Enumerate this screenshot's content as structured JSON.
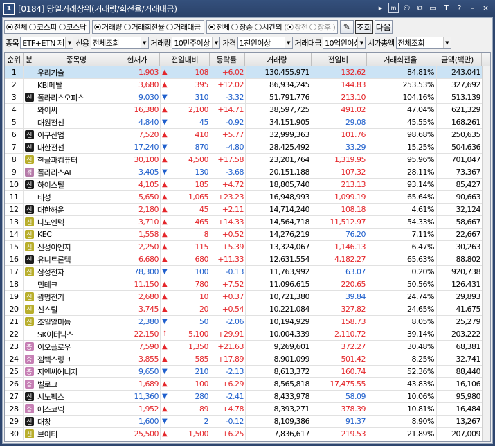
{
  "window": {
    "num": "1",
    "title": "[0184] 당일거래상위(거래량/회전율/거래대금)"
  },
  "market_options": [
    {
      "label": "전체",
      "on": true
    },
    {
      "label": "코스피",
      "on": false
    },
    {
      "label": "코스닥",
      "on": false
    }
  ],
  "sort_options": [
    {
      "label": "거래량",
      "on": true
    },
    {
      "label": "거래회전율",
      "on": false
    },
    {
      "label": "거래대금",
      "on": false
    }
  ],
  "session_options": [
    {
      "label": "전체",
      "on": true
    },
    {
      "label": "장중",
      "on": false
    },
    {
      "label": "시간외",
      "on": false
    }
  ],
  "sub_session": [
    "장전",
    "장후"
  ],
  "buttons": {
    "lookup": "조회",
    "next": "다음"
  },
  "filters": {
    "stock_label": "종목",
    "stock_value": "ETF+ETN 제",
    "credit_label": "신용",
    "credit_value": "전체조회",
    "volume_label": "거래량",
    "volume_value": "10만주이상",
    "price_label": "가격",
    "price_value": "1천원이상",
    "amount_label": "거래대금",
    "amount_value": "10억원이상",
    "mcap_label": "시가총액",
    "mcap_value": "전체조회"
  },
  "columns": [
    "순위",
    "분",
    "종목명",
    "현재가",
    "전일대비",
    "등락률",
    "거래량",
    "전일비",
    "거래회전율",
    "금액(백만)"
  ],
  "colors": {
    "up": "#e4262a",
    "down": "#1f5fcc",
    "selected": "#cbe3f5"
  },
  "rows": [
    {
      "rank": "1",
      "badge": "",
      "name": "우리기술",
      "price": "1,903",
      "dir": "up",
      "change": "108",
      "rate": "+6.02",
      "volume": "130,455,971",
      "prev": "132.62",
      "prevc": "up",
      "turnover": "84.81%",
      "amount": "243,041"
    },
    {
      "rank": "2",
      "badge": "",
      "name": "KBI메탈",
      "price": "3,680",
      "dir": "up",
      "change": "395",
      "rate": "+12.02",
      "volume": "86,934,245",
      "prev": "144.83",
      "prevc": "up",
      "turnover": "253.53%",
      "amount": "327,692"
    },
    {
      "rank": "3",
      "badge": "신",
      "name": "폴라리스오피스",
      "price": "9,030",
      "dir": "dn",
      "change": "310",
      "rate": "-3.32",
      "volume": "51,791,776",
      "prev": "213.10",
      "prevc": "up",
      "turnover": "104.16%",
      "amount": "513,139"
    },
    {
      "rank": "4",
      "badge": "",
      "name": "와이씨",
      "price": "16,380",
      "dir": "up",
      "change": "2,100",
      "rate": "+14.71",
      "volume": "38,597,725",
      "prev": "491.02",
      "prevc": "up",
      "turnover": "47.04%",
      "amount": "621,329"
    },
    {
      "rank": "5",
      "badge": "",
      "name": "대원전선",
      "price": "4,840",
      "dir": "dn",
      "change": "45",
      "rate": "-0.92",
      "volume": "34,151,905",
      "prev": "29.08",
      "prevc": "dn",
      "turnover": "45.55%",
      "amount": "168,261"
    },
    {
      "rank": "6",
      "badge": "신",
      "name": "이구산업",
      "price": "7,520",
      "dir": "up",
      "change": "410",
      "rate": "+5.77",
      "volume": "32,999,363",
      "prev": "101.76",
      "prevc": "up",
      "turnover": "98.68%",
      "amount": "250,635"
    },
    {
      "rank": "7",
      "badge": "신",
      "name": "대한전선",
      "price": "17,240",
      "dir": "dn",
      "change": "870",
      "rate": "-4.80",
      "volume": "28,425,492",
      "prev": "33.29",
      "prevc": "dn",
      "turnover": "15.25%",
      "amount": "504,636"
    },
    {
      "rank": "8",
      "badge": "신",
      "name": "한글과컴퓨터",
      "price": "30,100",
      "dir": "up",
      "change": "4,500",
      "rate": "+17.58",
      "volume": "23,201,764",
      "prev": "1,319.95",
      "prevc": "up",
      "turnover": "95.96%",
      "amount": "701,047"
    },
    {
      "rank": "9",
      "badge": "경",
      "name": "폴라리스AI",
      "price": "3,405",
      "dir": "dn",
      "change": "130",
      "rate": "-3.68",
      "volume": "20,151,188",
      "prev": "107.32",
      "prevc": "up",
      "turnover": "28.11%",
      "amount": "73,367"
    },
    {
      "rank": "10",
      "badge": "신",
      "name": "하이스틸",
      "price": "4,105",
      "dir": "up",
      "change": "185",
      "rate": "+4.72",
      "volume": "18,805,740",
      "prev": "213.13",
      "prevc": "up",
      "turnover": "93.14%",
      "amount": "85,427"
    },
    {
      "rank": "11",
      "badge": "",
      "name": "태성",
      "price": "5,650",
      "dir": "up",
      "change": "1,065",
      "rate": "+23.23",
      "volume": "16,948,993",
      "prev": "1,099.19",
      "prevc": "up",
      "turnover": "65.64%",
      "amount": "90,663"
    },
    {
      "rank": "12",
      "badge": "신",
      "name": "대한해운",
      "price": "2,180",
      "dir": "up",
      "change": "45",
      "rate": "+2.11",
      "volume": "14,714,240",
      "prev": "108.18",
      "prevc": "up",
      "turnover": "4.61%",
      "amount": "32,124"
    },
    {
      "rank": "13",
      "badge": "신",
      "name": "나노엔텍",
      "price": "3,710",
      "dir": "up",
      "change": "465",
      "rate": "+14.33",
      "volume": "14,564,718",
      "prev": "11,512.97",
      "prevc": "up",
      "turnover": "54.33%",
      "amount": "58,667"
    },
    {
      "rank": "14",
      "badge": "신",
      "name": "KEC",
      "price": "1,558",
      "dir": "up",
      "change": "8",
      "rate": "+0.52",
      "volume": "14,276,219",
      "prev": "76.20",
      "prevc": "dn",
      "turnover": "7.11%",
      "amount": "22,667"
    },
    {
      "rank": "15",
      "badge": "신",
      "name": "신성이엔지",
      "price": "2,250",
      "dir": "up",
      "change": "115",
      "rate": "+5.39",
      "volume": "13,324,067",
      "prev": "1,146.13",
      "prevc": "up",
      "turnover": "6.47%",
      "amount": "30,263"
    },
    {
      "rank": "16",
      "badge": "신",
      "name": "유니트론텍",
      "price": "6,680",
      "dir": "up",
      "change": "680",
      "rate": "+11.33",
      "volume": "12,631,554",
      "prev": "4,182.27",
      "prevc": "up",
      "turnover": "65.63%",
      "amount": "88,802"
    },
    {
      "rank": "17",
      "badge": "신",
      "name": "삼성전자",
      "price": "78,300",
      "dir": "dn",
      "change": "100",
      "rate": "-0.13",
      "volume": "11,763,992",
      "prev": "63.07",
      "prevc": "dn",
      "turnover": "0.20%",
      "amount": "920,738"
    },
    {
      "rank": "18",
      "badge": "",
      "name": "민테크",
      "price": "11,150",
      "dir": "up",
      "change": "780",
      "rate": "+7.52",
      "volume": "11,096,615",
      "prev": "220.65",
      "prevc": "up",
      "turnover": "50.56%",
      "amount": "126,431"
    },
    {
      "rank": "19",
      "badge": "신",
      "name": "광명전기",
      "price": "2,680",
      "dir": "up",
      "change": "10",
      "rate": "+0.37",
      "volume": "10,721,380",
      "prev": "39.84",
      "prevc": "dn",
      "turnover": "24.74%",
      "amount": "29,893"
    },
    {
      "rank": "20",
      "badge": "신",
      "name": "신스틸",
      "price": "3,745",
      "dir": "up",
      "change": "20",
      "rate": "+0.54",
      "volume": "10,221,084",
      "prev": "327.82",
      "prevc": "up",
      "turnover": "24.65%",
      "amount": "41,675"
    },
    {
      "rank": "21",
      "badge": "신",
      "name": "조일알미늄",
      "price": "2,380",
      "dir": "dn",
      "change": "50",
      "rate": "-2.06",
      "volume": "10,194,929",
      "prev": "158.73",
      "prevc": "up",
      "turnover": "8.05%",
      "amount": "25,279"
    },
    {
      "rank": "22",
      "badge": "",
      "name": "SK이터닉스",
      "price": "22,150",
      "dir": "upper",
      "change": "5,100",
      "rate": "+29.91",
      "volume": "10,004,339",
      "prev": "2,110.72",
      "prevc": "up",
      "turnover": "39.14%",
      "amount": "203,222"
    },
    {
      "rank": "23",
      "badge": "증",
      "name": "이오플로우",
      "price": "7,590",
      "dir": "up",
      "change": "1,350",
      "rate": "+21.63",
      "volume": "9,269,601",
      "prev": "372.27",
      "prevc": "up",
      "turnover": "30.48%",
      "amount": "68,381"
    },
    {
      "rank": "24",
      "badge": "증",
      "name": "젬백스링크",
      "price": "3,855",
      "dir": "up",
      "change": "585",
      "rate": "+17.89",
      "volume": "8,901,099",
      "prev": "501.42",
      "prevc": "up",
      "turnover": "8.25%",
      "amount": "32,741"
    },
    {
      "rank": "25",
      "badge": "증",
      "name": "지엔씨에너지",
      "price": "9,650",
      "dir": "dn",
      "change": "210",
      "rate": "-2.13",
      "volume": "8,613,372",
      "prev": "160.74",
      "prevc": "up",
      "turnover": "52.36%",
      "amount": "88,440"
    },
    {
      "rank": "26",
      "badge": "증",
      "name": "벨로크",
      "price": "1,689",
      "dir": "up",
      "change": "100",
      "rate": "+6.29",
      "volume": "8,565,818",
      "prev": "17,475.55",
      "prevc": "up",
      "turnover": "43.83%",
      "amount": "16,106"
    },
    {
      "rank": "27",
      "badge": "신",
      "name": "시노펙스",
      "price": "11,360",
      "dir": "dn",
      "change": "280",
      "rate": "-2.41",
      "volume": "8,433,978",
      "prev": "58.09",
      "prevc": "dn",
      "turnover": "10.06%",
      "amount": "95,980"
    },
    {
      "rank": "28",
      "badge": "증",
      "name": "에스코넥",
      "price": "1,952",
      "dir": "up",
      "change": "89",
      "rate": "+4.78",
      "volume": "8,393,271",
      "prev": "378.39",
      "prevc": "up",
      "turnover": "10.81%",
      "amount": "16,484"
    },
    {
      "rank": "29",
      "badge": "신",
      "name": "대창",
      "price": "1,600",
      "dir": "dn",
      "change": "2",
      "rate": "-0.12",
      "volume": "8,109,386",
      "prev": "91.37",
      "prevc": "dn",
      "turnover": "8.90%",
      "amount": "13,267"
    },
    {
      "rank": "30",
      "badge": "신",
      "name": "브이티",
      "price": "25,500",
      "dir": "up",
      "change": "1,500",
      "rate": "+6.25",
      "volume": "7,836,617",
      "prev": "219.53",
      "prevc": "up",
      "turnover": "21.89%",
      "amount": "207,009"
    }
  ]
}
